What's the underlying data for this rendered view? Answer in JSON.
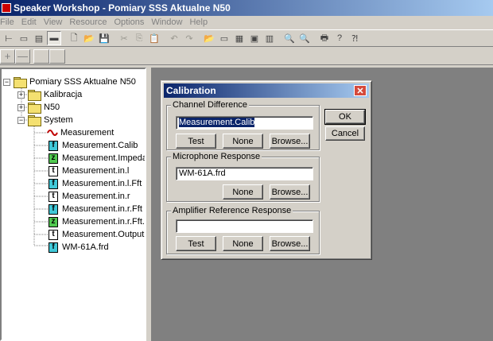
{
  "app": {
    "title": "Speaker Workshop - Pomiary SSS Aktualne N50"
  },
  "menu": [
    "File",
    "Edit",
    "View",
    "Resource",
    "Options",
    "Window",
    "Help"
  ],
  "toolbar": {
    "buttons": [
      {
        "name": "view-tree-icon",
        "glyph": "⊢"
      },
      {
        "name": "view-list-icon",
        "glyph": "▭"
      },
      {
        "name": "view-details-icon",
        "glyph": "▤"
      },
      {
        "name": "view-large-icon",
        "glyph": "▬"
      },
      {
        "name": "new-file-icon",
        "glyph": "🗋"
      },
      {
        "name": "open-folder-icon",
        "glyph": "📂"
      },
      {
        "name": "save-icon",
        "glyph": "💾"
      },
      {
        "name": "cut-icon",
        "glyph": "✂"
      },
      {
        "name": "copy-icon",
        "glyph": "⎘"
      },
      {
        "name": "paste-icon",
        "glyph": "📋"
      },
      {
        "name": "undo-icon",
        "glyph": "↶"
      },
      {
        "name": "redo-icon",
        "glyph": "↷"
      },
      {
        "name": "open-doc-icon",
        "glyph": "📂"
      },
      {
        "name": "chart-icon",
        "glyph": "▭"
      },
      {
        "name": "image-icon",
        "glyph": "▦"
      },
      {
        "name": "measure-icon",
        "glyph": "▣"
      },
      {
        "name": "calc-icon",
        "glyph": "▥"
      },
      {
        "name": "zoom-in-icon",
        "glyph": "🔍"
      },
      {
        "name": "zoom-out-icon",
        "glyph": "🔍"
      },
      {
        "name": "print-icon",
        "glyph": "🖶"
      },
      {
        "name": "help-icon",
        "glyph": "?"
      },
      {
        "name": "context-help-icon",
        "glyph": "⁈"
      }
    ]
  },
  "toolbar2": {
    "plus": "+",
    "minus": "—"
  },
  "tree": {
    "root": "Pomiary SSS Aktualne N50",
    "folders": [
      "Kalibracja",
      "N50",
      "System"
    ],
    "items": [
      {
        "label": "Measurement",
        "icon": "wave"
      },
      {
        "label": "Measurement.Calib",
        "icon": "f"
      },
      {
        "label": "Measurement.Impedance",
        "icon": "z"
      },
      {
        "label": "Measurement.in.l",
        "icon": "t"
      },
      {
        "label": "Measurement.in.l.Fft",
        "icon": "f"
      },
      {
        "label": "Measurement.in.r",
        "icon": "t"
      },
      {
        "label": "Measurement.in.r.Fft",
        "icon": "f"
      },
      {
        "label": "Measurement.in.r.Fft.Z",
        "icon": "z"
      },
      {
        "label": "Measurement.Output",
        "icon": "t"
      },
      {
        "label": "WM-61A.frd",
        "icon": "f"
      }
    ]
  },
  "dialog": {
    "title": "Calibration",
    "close": "✕",
    "ok": "OK",
    "cancel": "Cancel",
    "channel": {
      "label": "Channel Difference",
      "value": "Measurement.Calib",
      "test": "Test",
      "none": "None",
      "browse": "Browse..."
    },
    "mic": {
      "label": "Microphone Response",
      "value": "WM-61A.frd",
      "none": "None",
      "browse": "Browse..."
    },
    "amp": {
      "label": "Amplifier Reference Response",
      "value": "",
      "test": "Test",
      "none": "None",
      "browse": "Browse..."
    }
  }
}
